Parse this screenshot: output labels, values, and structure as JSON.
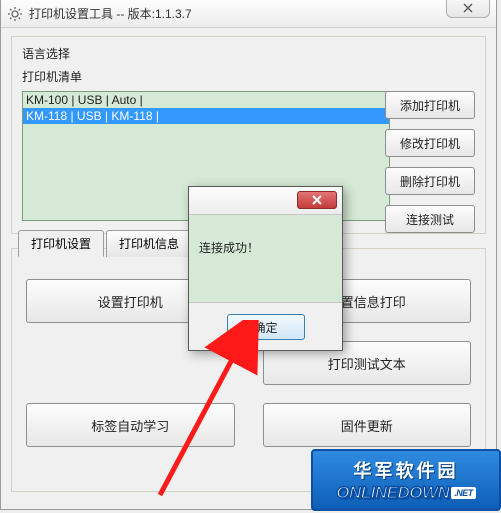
{
  "window": {
    "title": "打印机设置工具 -- 版本:1.1.3.7"
  },
  "group1": {
    "lang_label": "语言选择",
    "list_label": "打印机清单",
    "printers": [
      {
        "text": "KM-100 | USB | Auto |",
        "selected": false
      },
      {
        "text": "KM-118 | USB | KM-118 |",
        "selected": true
      }
    ]
  },
  "side_buttons": {
    "add": "添加打印机",
    "edit": "修改打印机",
    "delete": "删除打印机",
    "test_conn": "连接测试"
  },
  "tabs": {
    "t1": "打印机设置",
    "t2": "打印机信息"
  },
  "big_buttons": {
    "set_printer": "设置打印机",
    "print_config": "配置信息打印",
    "print_test_text": "打印测试文本",
    "label_auto_learn": "标签自动学习",
    "firmware_update": "固件更新"
  },
  "dialog": {
    "message": "连接成功！",
    "ok": "确定"
  },
  "watermark": {
    "cn": "华军软件园",
    "en": "ONLINEDOWN",
    "net": ".NET"
  }
}
